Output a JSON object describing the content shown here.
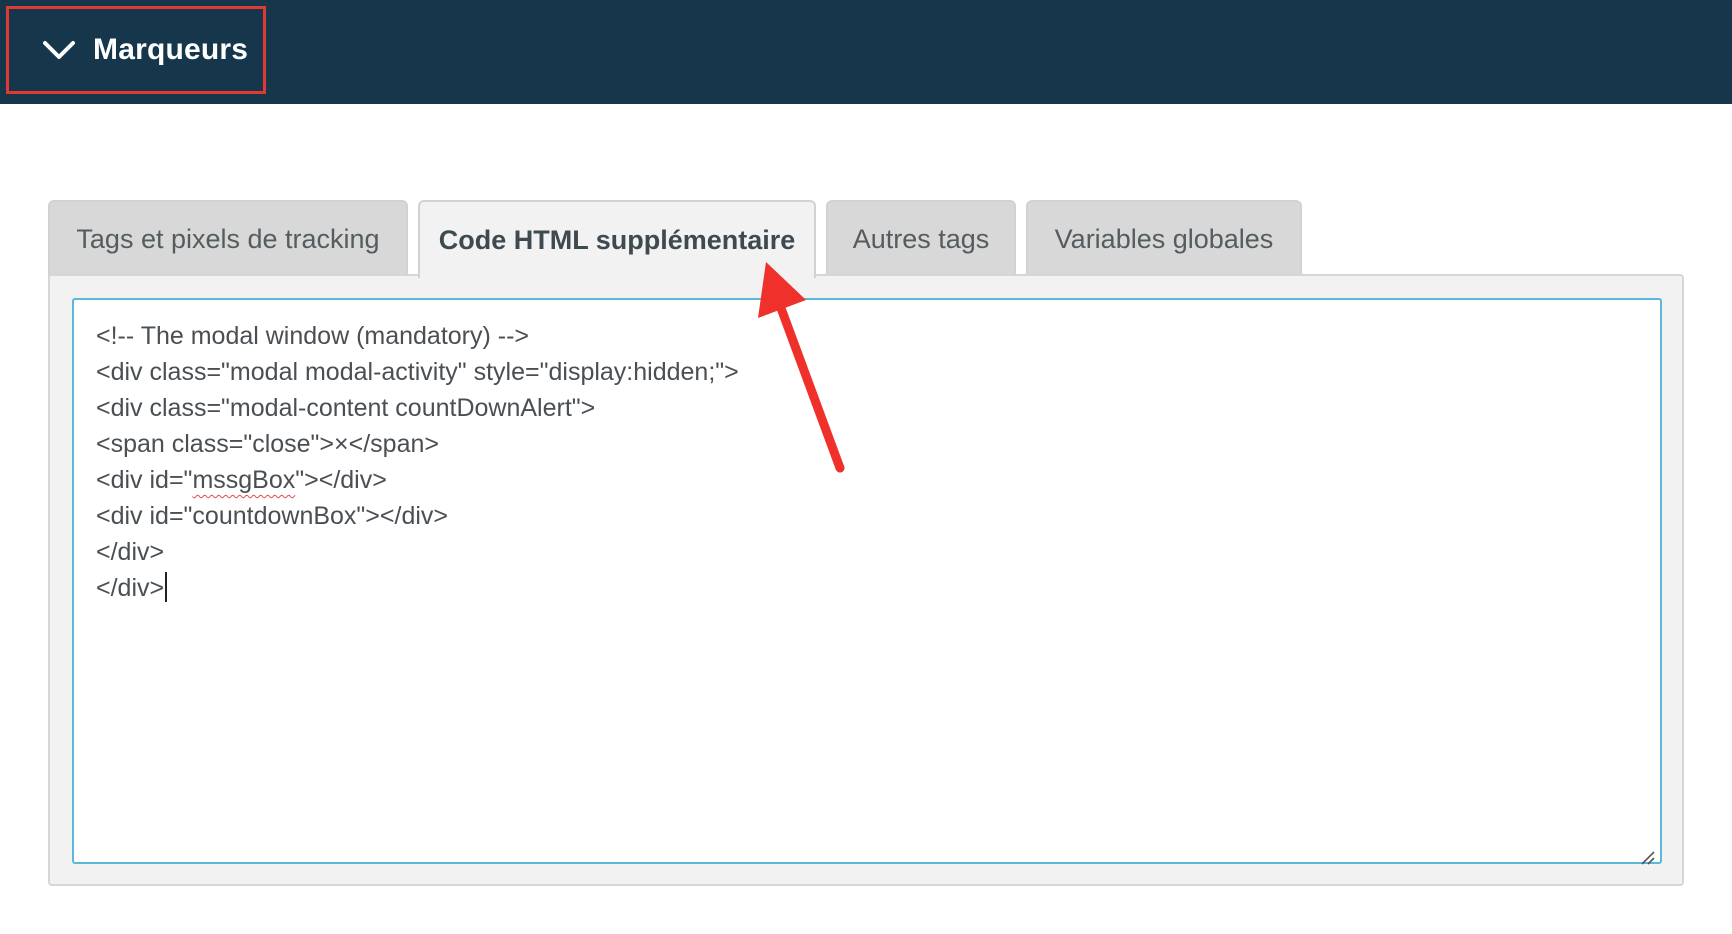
{
  "header": {
    "title": "Marqueurs",
    "toggle_icon": "chevron-down-icon",
    "background_color": "#16364b",
    "highlight_color": "#e03a33"
  },
  "tabs": [
    {
      "label": "Tags et pixels de tracking",
      "active": false
    },
    {
      "label": "Code HTML supplémentaire",
      "active": true
    },
    {
      "label": "Autres tags",
      "active": false
    },
    {
      "label": "Variables globales",
      "active": false
    }
  ],
  "editor": {
    "border_color": "#5bb8dc",
    "lines": [
      "<!-- The modal window (mandatory) -->",
      "<div class=\"modal modal-activity\" style=\"display:hidden;\">",
      "<div class=\"modal-content countDownAlert\">",
      "<span class=\"close\">×</span>",
      "<div id=\"",
      "mssgBox",
      "\"></div>",
      "<div id=\"countdownBox\"></div>",
      "</div>",
      "</div>"
    ]
  },
  "annotation": {
    "arrow_color": "#f0302a"
  }
}
